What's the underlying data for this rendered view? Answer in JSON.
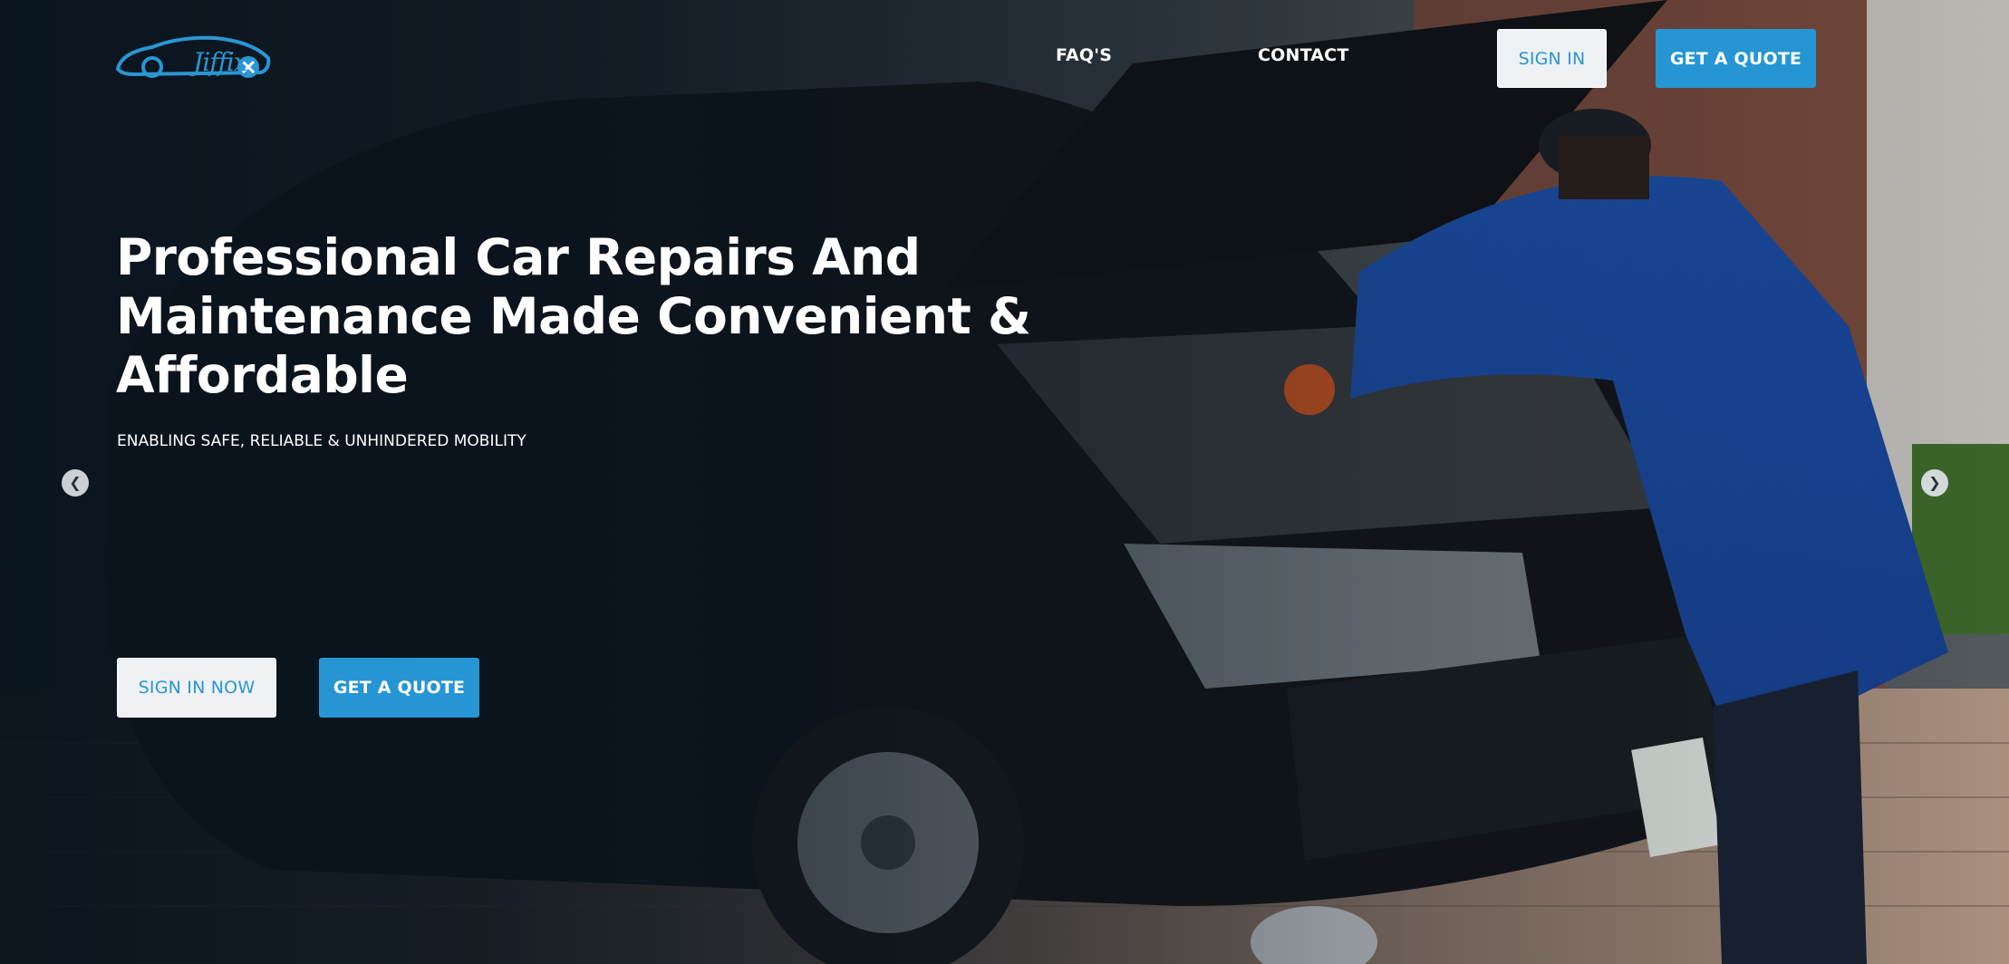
{
  "brand": {
    "logo_text": "Jiffix",
    "accent_color": "#2596d3"
  },
  "nav": {
    "faq_label": "FAQ'S",
    "contact_label": "CONTACT",
    "signin_label": "SIGN IN",
    "quote_label": "GET A QUOTE"
  },
  "hero": {
    "title_line1": "Professional Car Repairs And",
    "title_line2": "Maintenance Made Convenient &",
    "title_line3": "Affordable",
    "subtitle": "ENABLING SAFE, RELIABLE & UNHINDERED MOBILITY",
    "signin_now_label": "SIGN IN NOW",
    "quote_label": "GET A QUOTE"
  },
  "carousel": {
    "prev_icon": "chevron-left-icon",
    "next_icon": "chevron-right-icon",
    "prev_glyph": "❮",
    "next_glyph": "❯"
  },
  "background": {
    "description_icon": "car-repair-photo"
  }
}
